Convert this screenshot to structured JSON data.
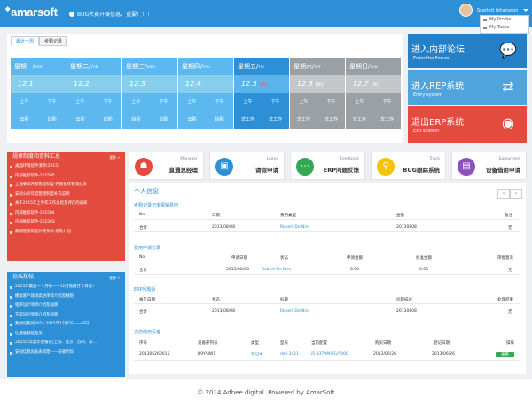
{
  "header": {
    "logo": "amarsoft",
    "notice": "BUG大赛开赛信息，重要！！！",
    "user": "Scarlett Johansson",
    "menu": [
      "My Profile",
      "My Tasks"
    ]
  },
  "week": {
    "tabs": [
      "最近一周",
      "考勤记录"
    ],
    "days": [
      {
        "cn": "星期一",
        "en": "MON",
        "date": "12.1",
        "tag": "",
        "am": "上午",
        "pm": "下午",
        "am_s": "出勤",
        "pm_s": "出勤",
        "style": "lblue"
      },
      {
        "cn": "星期二",
        "en": "TUE",
        "date": "12.2",
        "tag": "",
        "am": "上午",
        "pm": "下午",
        "am_s": "出勤",
        "pm_s": "出勤",
        "style": "lblue"
      },
      {
        "cn": "星期三",
        "en": "WED",
        "date": "12.3",
        "tag": "",
        "am": "上午",
        "pm": "下午",
        "am_s": "缺勤",
        "pm_s": "出勤",
        "style": "lblue"
      },
      {
        "cn": "星期四",
        "en": "THU",
        "date": "12.4",
        "tag": "",
        "am": "上午",
        "pm": "下午",
        "am_s": "出勤",
        "pm_s": "缺勤",
        "style": "lblue"
      },
      {
        "cn": "星期五",
        "en": "FRI",
        "date": "12.5",
        "tag": "[休]",
        "am": "上午",
        "pm": "下午",
        "am_s": "非工作",
        "pm_s": "非工作",
        "style": "mblue"
      },
      {
        "cn": "星期六",
        "en": "SAT",
        "date": "12.6",
        "tag": "[休]",
        "am": "上午",
        "pm": "下午",
        "am_s": "非工作",
        "pm_s": "非工作",
        "style": "grey"
      },
      {
        "cn": "星期日",
        "en": "SUN",
        "date": "12.7",
        "tag": "[休]",
        "am": "上午",
        "pm": "下午",
        "am_s": "非工作",
        "pm_s": "非工作",
        "style": "grey"
      }
    ]
  },
  "tiles": [
    {
      "title": "进入内部论坛",
      "sub": "Enter the Forum",
      "color": "#2580c8",
      "icon": "chat-icon",
      "glyph": "💬"
    },
    {
      "title": "进入REP系统",
      "sub": "Entry system",
      "color": "#4fa4de",
      "icon": "shuffle-icon",
      "glyph": "⇄"
    },
    {
      "title": "退出ERP系统",
      "sub": "Exit system",
      "color": "#e24b3d",
      "icon": "globe-icon",
      "glyph": "◉"
    }
  ],
  "rules": {
    "title": "规章制度和资料汇总",
    "more": "更多 »",
    "items": [
      "桌面环境软件清单(2015)",
      "内部推荐软件-201505",
      "上海安硕内部管理制度-内部推荐管理办法",
      "安硕公司年度管理制度补充说明",
      "关于2015年上半年工作总结及评优的通知",
      "内部推荐软件-201504",
      "内部推荐软件-201503",
      "薪酬管理制度补充条款-绩效计划"
    ]
  },
  "forum": {
    "title": "论坛热帖",
    "more": "更多 »",
    "items": [
      "2015年最后一个月啦——12月我最打卡目标！",
      "模拟客户现场高仿项目介绍及规则",
      "程序设计项目介绍及规则",
      "方案设计项目介绍及规则",
      "我想说我的2015.2015年12月5日——6日...",
      "吐槽版诚征意见！",
      "2015年年度年会报名(上海、北京、苏州、深...",
      "安硕信息再发表辉煌——安硕代码"
    ]
  },
  "shortcuts": [
    {
      "en": "Manager",
      "cn": "直通总经理",
      "color": "#e24b3d",
      "icon": "manager-icon",
      "glyph": "☗"
    },
    {
      "en": "Leave",
      "cn": "请假申请",
      "color": "#2d8fd5",
      "icon": "leave-icon",
      "glyph": "▣"
    },
    {
      "en": "Feedback",
      "cn": "ERP问题反馈",
      "color": "#34a853",
      "icon": "feedback-icon",
      "glyph": "⋯"
    },
    {
      "en": "Track",
      "cn": "BUG跟踪系统",
      "color": "#f5c400",
      "icon": "track-icon",
      "glyph": "⚲"
    },
    {
      "en": "Equipment",
      "cn": "设备借用申请",
      "color": "#8e4fbf",
      "icon": "equipment-icon",
      "glyph": "▤"
    }
  ],
  "panel": {
    "title": "个人信息",
    "s1": {
      "title": "考勤记录记未报销费用",
      "cols": [
        "No.",
        "日期",
        "费用类型",
        "金额",
        "备注"
      ],
      "row": [
        "合计",
        "2013/08/08",
        "Robert De Niro",
        "20130808",
        "无"
      ]
    },
    "s2": {
      "title": "费用申请记录",
      "cols": [
        "No.",
        "申请日期",
        "状态",
        "申请金额",
        "批准金额",
        "审批意见"
      ],
      "row": [
        "合计",
        "2013/08/08",
        "Robert De Niro",
        "0.00",
        "0.00",
        "无"
      ]
    },
    "s3": {
      "title": "ERP问题反",
      "cols": [
        "报告日期",
        "状态",
        "标题",
        "问题描述",
        "处理结果"
      ],
      "row": [
        "合计",
        "2013/08/08",
        "Robert De Niro",
        "20130808",
        "无"
      ]
    },
    "s4": {
      "title": "当前借用设备",
      "cols": [
        "序号",
        "设备序列号",
        "类型",
        "型号",
        "当前配置",
        "购买日期",
        "登记日期",
        "操作"
      ],
      "row": [
        "201306260015",
        "B9YSJW1",
        "笔记本",
        "dell 3421",
        "i5-3379M/4G/500G",
        "2013/06/26",
        "2013/06/26",
        "查看"
      ]
    }
  },
  "footer": "© 2014 Adbee digital. Powered by AmarSoft"
}
